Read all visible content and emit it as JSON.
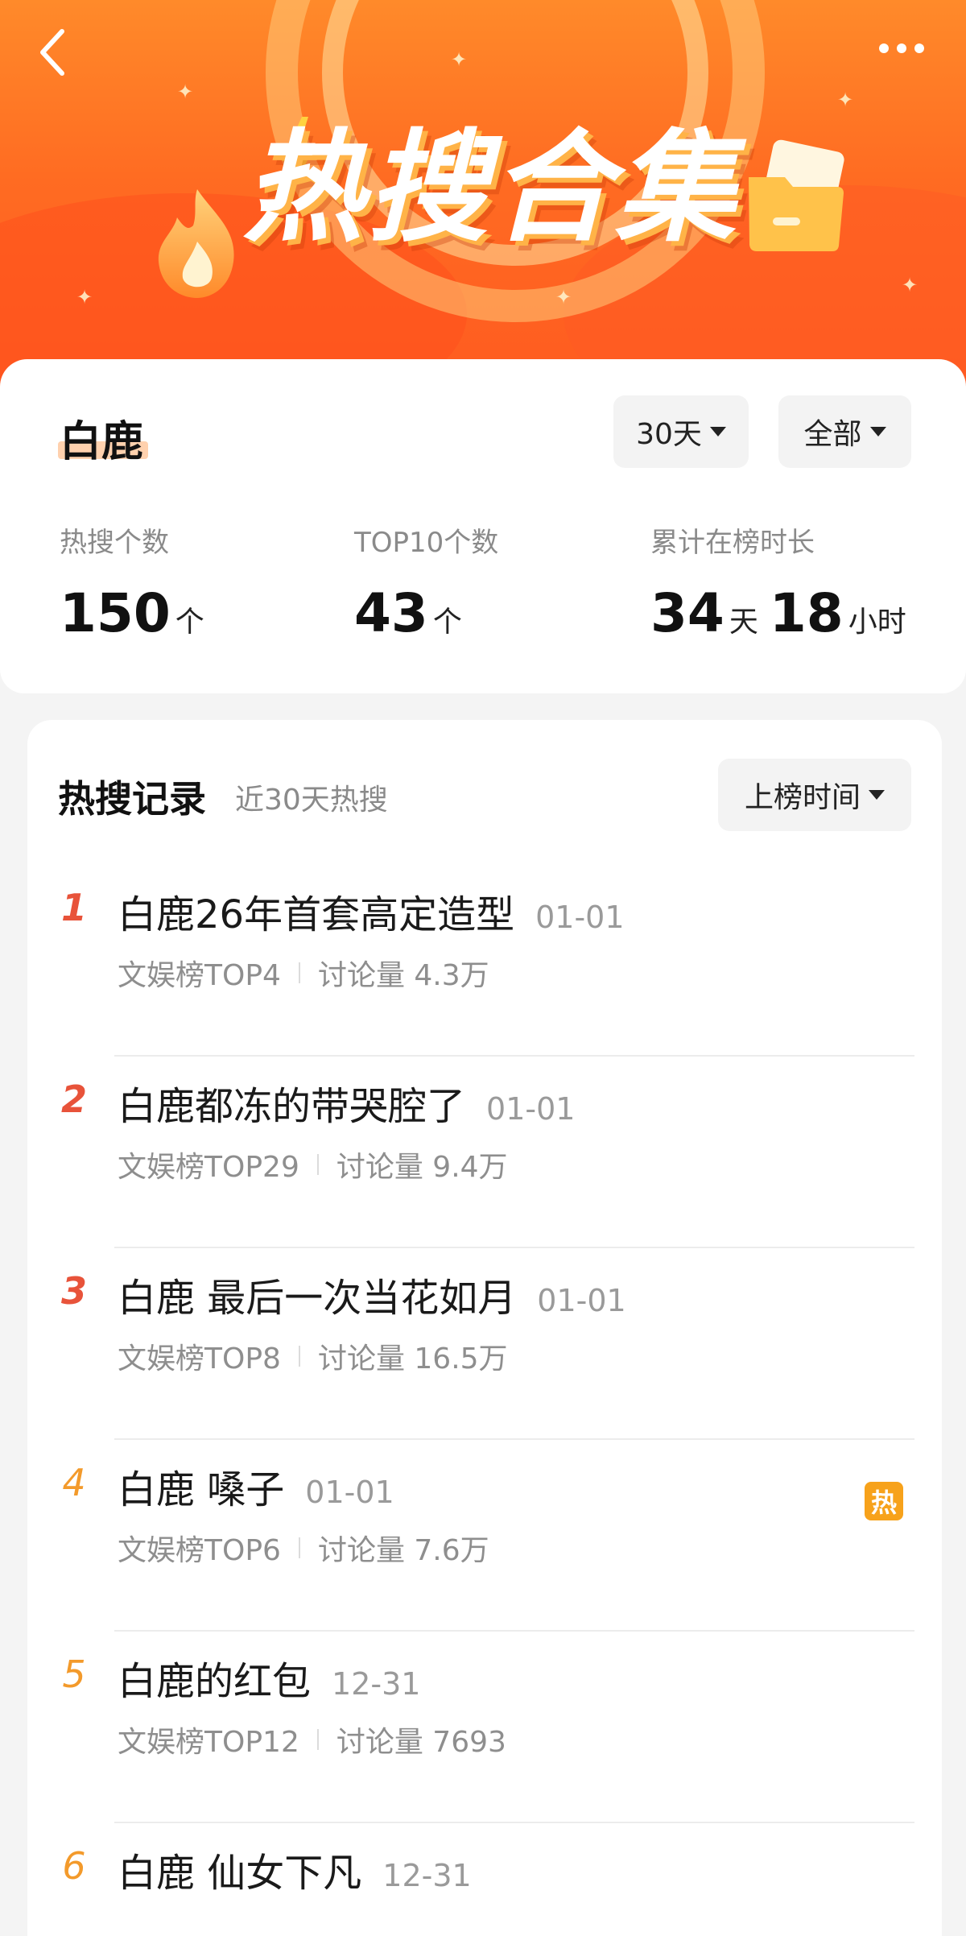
{
  "banner": {
    "title": "热搜合集"
  },
  "summary": {
    "name": "白鹿",
    "filters": {
      "days": "30天",
      "scope": "全部"
    },
    "stats": [
      {
        "label": "热搜个数",
        "value": "150",
        "unit": "个"
      },
      {
        "label": "TOP10个数",
        "value": "43",
        "unit": "个"
      },
      {
        "label": "累计在榜时长",
        "days": "34",
        "days_unit": "天",
        "hours": "18",
        "hours_unit": "小时"
      }
    ]
  },
  "records": {
    "title": "热搜记录",
    "subtitle": "近30天热搜",
    "sort": "上榜时间",
    "items": [
      {
        "rank": "1",
        "title": "白鹿26年首套高定造型",
        "date": "01-01",
        "board": "文娱榜TOP4",
        "discussion": "讨论量 4.3万"
      },
      {
        "rank": "2",
        "title": "白鹿都冻的带哭腔了",
        "date": "01-01",
        "board": "文娱榜TOP29",
        "discussion": "讨论量 9.4万"
      },
      {
        "rank": "3",
        "title": "白鹿 最后一次当花如月",
        "date": "01-01",
        "board": "文娱榜TOP8",
        "discussion": "讨论量 16.5万"
      },
      {
        "rank": "4",
        "title": "白鹿 嗓子",
        "date": "01-01",
        "board": "文娱榜TOP6",
        "discussion": "讨论量 7.6万",
        "badge": "热"
      },
      {
        "rank": "5",
        "title": "白鹿的红包",
        "date": "12-31",
        "board": "文娱榜TOP12",
        "discussion": "讨论量 7693"
      },
      {
        "rank": "6",
        "title": "白鹿 仙女下凡",
        "date": "12-31",
        "board": "",
        "discussion": ""
      }
    ]
  },
  "colors": {
    "banner_orange": "#ff6b22",
    "rank_top": "#e8533a",
    "rank_other": "#f39a2b",
    "hot_badge": "#f7a21b"
  }
}
